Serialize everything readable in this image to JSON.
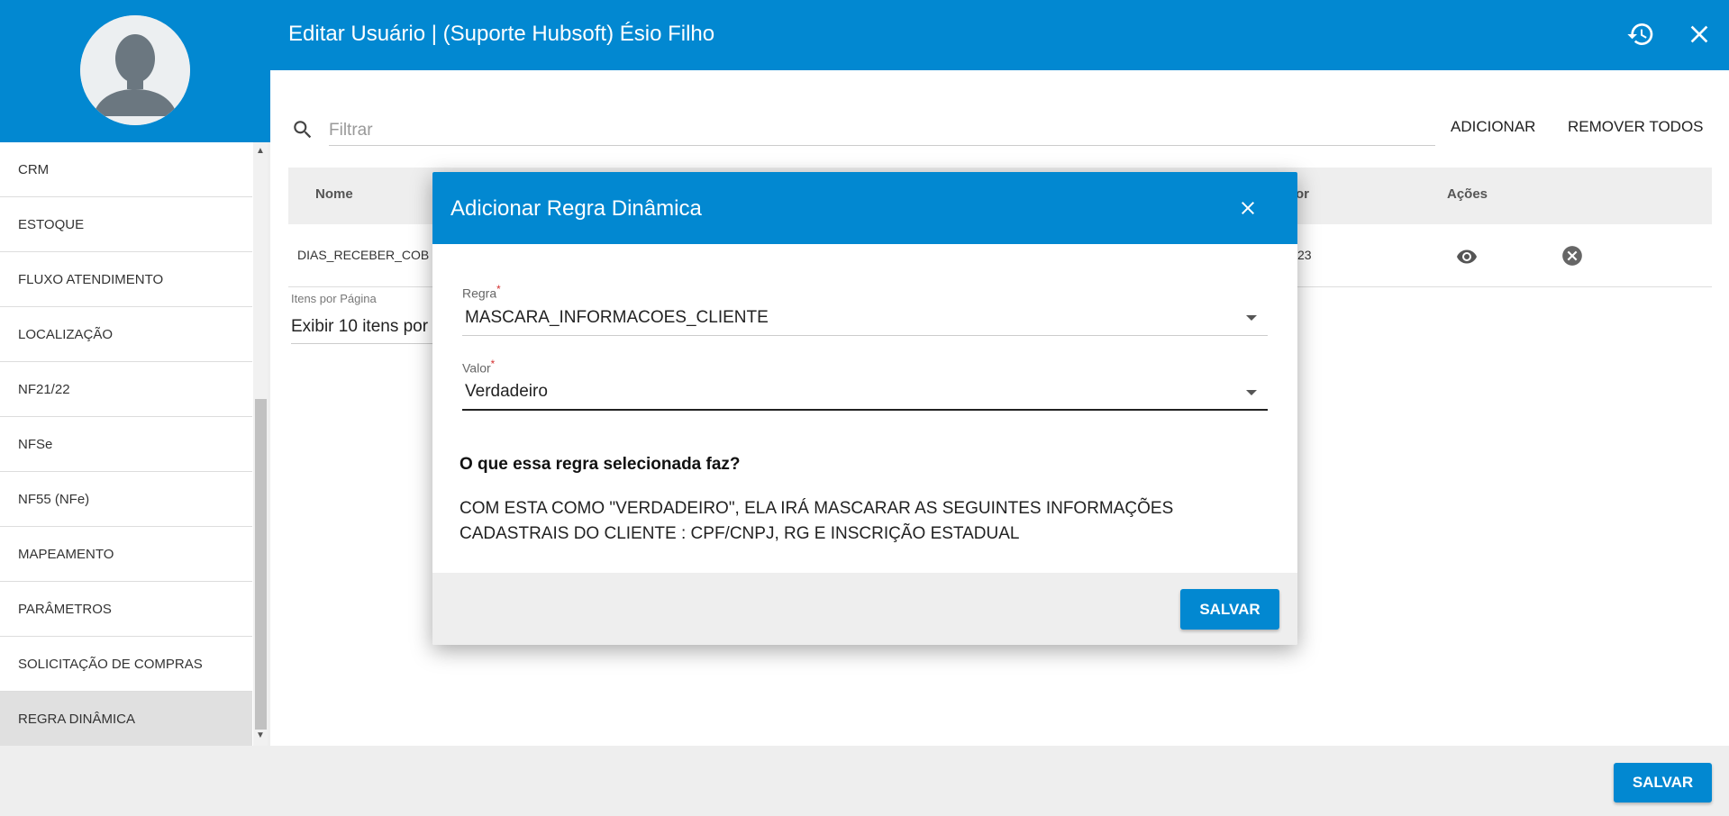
{
  "header": {
    "title": "Editar Usuário | (Suporte Hubsoft) Ésio Filho",
    "history_icon": "history-icon",
    "close_icon": "close-icon",
    "color": "#0288d1"
  },
  "sidebar": {
    "items": [
      {
        "label": "CRM"
      },
      {
        "label": "ESTOQUE"
      },
      {
        "label": "FLUXO ATENDIMENTO"
      },
      {
        "label": "LOCALIZAÇÃO"
      },
      {
        "label": "NF21/22"
      },
      {
        "label": "NFSe"
      },
      {
        "label": "NF55 (NFe)"
      },
      {
        "label": "MAPEAMENTO"
      },
      {
        "label": "PARÂMETROS"
      },
      {
        "label": "SOLICITAÇÃO DE COMPRAS"
      },
      {
        "label": "REGRA DINÂMICA",
        "active": true
      }
    ]
  },
  "main": {
    "filter_placeholder": "Filtrar",
    "add_label": "ADICIONAR",
    "remove_all_label": "REMOVER TODOS",
    "table": {
      "columns": [
        "Nome",
        "or",
        "Ações"
      ],
      "rows": [
        {
          "name": "DIAS_RECEBER_COB",
          "value": "23"
        }
      ]
    },
    "pager": {
      "label": "Itens por Página",
      "value": "Exibir 10 itens por"
    }
  },
  "dialog": {
    "title": "Adicionar Regra Dinâmica",
    "regra_label": "Regra",
    "regra_value": "MASCARA_INFORMACOES_CLIENTE",
    "valor_label": "Valor",
    "valor_value": "Verdadeiro",
    "required_mark": "*",
    "question": "O que essa regra selecionada faz?",
    "description": "COM ESTA COMO \"VERDADEIRO\", ELA IRÁ MASCARAR AS SEGUINTES INFORMAÇÕES CADASTRAIS DO CLIENTE : CPF/CNPJ, RG E INSCRIÇÃO ESTADUAL",
    "save_label": "SALVAR"
  },
  "footer": {
    "save_label": "SALVAR"
  }
}
